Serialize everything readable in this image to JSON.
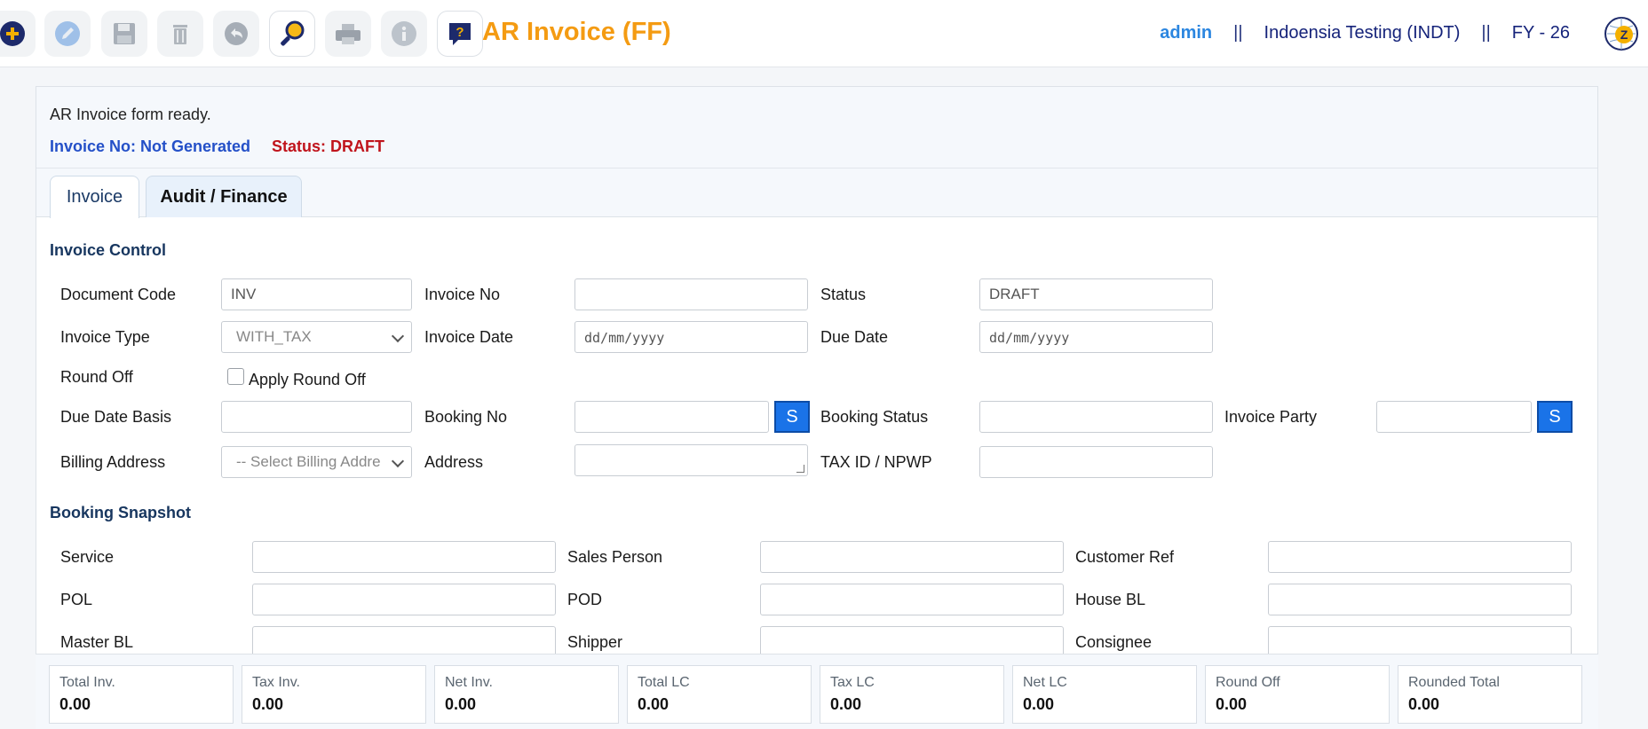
{
  "app": {
    "title": "AR Invoice (FF)",
    "user": "admin",
    "separator": "||",
    "company": "Indoensia Testing (INDT)",
    "fy": "FY - 26"
  },
  "toolbar": {
    "icons": [
      "add-icon",
      "edit-icon",
      "save-icon",
      "delete-icon",
      "undo-icon",
      "search-icon",
      "print-icon",
      "info-icon",
      "help-icon"
    ]
  },
  "messages": {
    "text": "AR Invoice form ready.",
    "invoice_no": "Invoice No: Not Generated",
    "status": "Status: DRAFT"
  },
  "tabs": [
    "Invoice",
    "Audit / Finance"
  ],
  "invoice_control": {
    "title": "Invoice Control",
    "document_code_label": "Document Code",
    "document_code_value": "INV",
    "invoice_no_label": "Invoice No",
    "invoice_no_value": "",
    "status_label": "Status",
    "status_value": "DRAFT",
    "invoice_type_label": "Invoice Type",
    "invoice_type_value": "WITH_TAX",
    "invoice_date_label": "Invoice Date",
    "invoice_date_placeholder": "dd/mm/yyyy",
    "due_date_label": "Due Date",
    "due_date_placeholder": "dd/mm/yyyy",
    "round_off_label": "Round Off",
    "apply_round_off_label": "Apply Round Off",
    "due_date_basis_label": "Due Date Basis",
    "booking_no_label": "Booking No",
    "booking_status_label": "Booking Status",
    "invoice_party_label": "Invoice Party",
    "search_button": "S",
    "billing_address_label": "Billing Address",
    "billing_address_placeholder": "-- Select Billing Addre",
    "address_label": "Address",
    "tax_id_label": "TAX ID / NPWP"
  },
  "booking_snapshot": {
    "title": "Booking Snapshot",
    "service_label": "Service",
    "sales_person_label": "Sales Person",
    "customer_ref_label": "Customer Ref",
    "pol_label": "POL",
    "pod_label": "POD",
    "house_bl_label": "House BL",
    "master_bl_label": "Master BL",
    "shipper_label": "Shipper",
    "consignee_label": "Consignee"
  },
  "totals": [
    {
      "label": "Total Inv.",
      "value": "0.00"
    },
    {
      "label": "Tax Inv.",
      "value": "0.00"
    },
    {
      "label": "Net Inv.",
      "value": "0.00"
    },
    {
      "label": "Total LC",
      "value": "0.00"
    },
    {
      "label": "Tax LC",
      "value": "0.00"
    },
    {
      "label": "Net LC",
      "value": "0.00"
    },
    {
      "label": "Round Off",
      "value": "0.00"
    },
    {
      "label": "Rounded Total",
      "value": "0.00"
    }
  ],
  "colors": {
    "title": "#f49b12",
    "accent": "#1a73e8",
    "status": "#c0141c",
    "invoice_no": "#2450c8"
  }
}
